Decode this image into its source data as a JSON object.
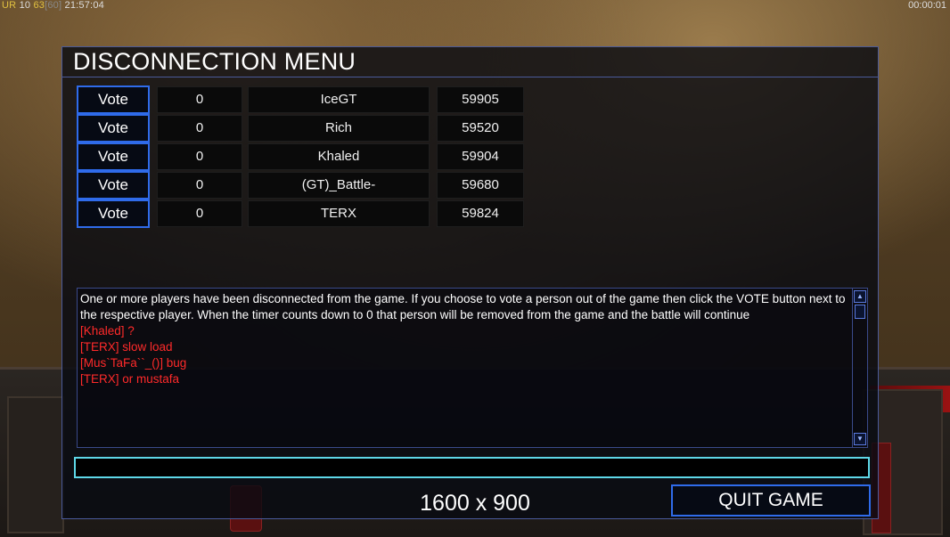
{
  "hud": {
    "ur_label": "UR",
    "ur_value": "10",
    "fps": "63",
    "fps_max": "[60]",
    "clock": "21:57:04",
    "game_timer": "00:00:01"
  },
  "dialog": {
    "title": "DISCONNECTION MENU",
    "vote_label": "Vote",
    "players": [
      {
        "votes": "0",
        "name": "IceGT",
        "ping": "59905"
      },
      {
        "votes": "0",
        "name": "Rich",
        "ping": "59520"
      },
      {
        "votes": "0",
        "name": "Khaled",
        "ping": "59904"
      },
      {
        "votes": "0",
        "name": "(GT)_Battle-",
        "ping": "59680"
      },
      {
        "votes": "0",
        "name": "TERX",
        "ping": "59824"
      }
    ],
    "message_intro": "One or more players have been disconnected from the game. If you choose to vote a person out of the game then click the VOTE button next to the respective player. When the timer counts down to 0 that person will be removed from the game and the battle will continue",
    "chat": [
      "[Khaled] ?",
      "[TERX] slow load",
      "[Mus`TaFa``_()] bug",
      "[TERX] or mustafa"
    ],
    "chat_input_value": "",
    "quit_label": "QUIT GAME"
  },
  "resolution_label": "1600 x 900",
  "colors": {
    "accent_border": "#2f6bea",
    "chat_red": "#ff2a2a",
    "input_cyan": "#5ed8e8"
  }
}
